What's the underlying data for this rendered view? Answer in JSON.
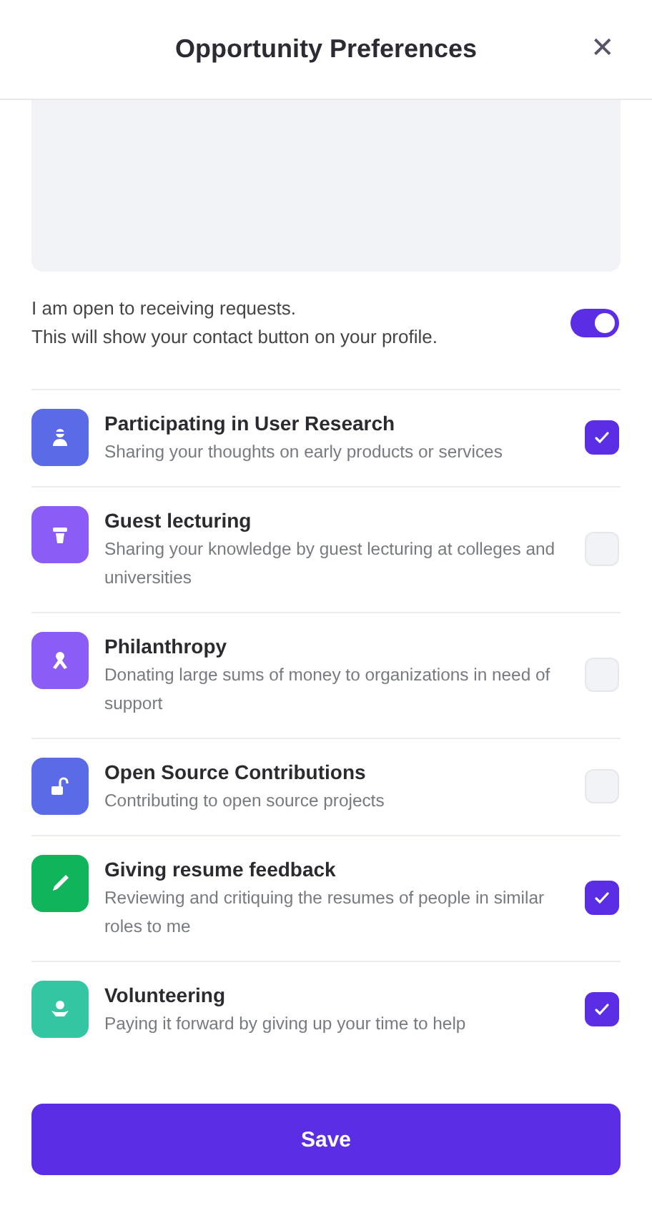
{
  "header": {
    "title": "Opportunity Preferences",
    "close": "✕"
  },
  "availability": {
    "lines": [
      "I am open to receiving requests.",
      "This will show your contact button on your profile."
    ],
    "on": true
  },
  "options": [
    {
      "kind": "person",
      "color": "#5b6be8",
      "title": "Participating in User Research",
      "description": "Sharing your thoughts on early products or services",
      "checked": true
    },
    {
      "kind": "podium",
      "color": "#8b5cf6",
      "title": "Guest lecturing",
      "description": "Sharing your knowledge by guest lecturing at colleges and universities",
      "checked": false
    },
    {
      "kind": "ribbon",
      "color": "#8b5cf6",
      "title": "Philanthropy",
      "description": "Donating large sums of money to organizations in need of support",
      "checked": false
    },
    {
      "kind": "lock",
      "color": "#5b6be8",
      "title": "Open Source Contributions",
      "description": "Contributing to open source projects",
      "checked": false
    },
    {
      "kind": "pen",
      "color": "#10b45a",
      "title": "Giving resume feedback",
      "description": "Reviewing and critiquing the resumes of people in similar roles to me",
      "checked": true
    },
    {
      "kind": "hands",
      "color": "#34c6a2",
      "title": "Volunteering",
      "description": "Paying it forward by giving up your time to help",
      "checked": true
    }
  ],
  "save": "Save"
}
